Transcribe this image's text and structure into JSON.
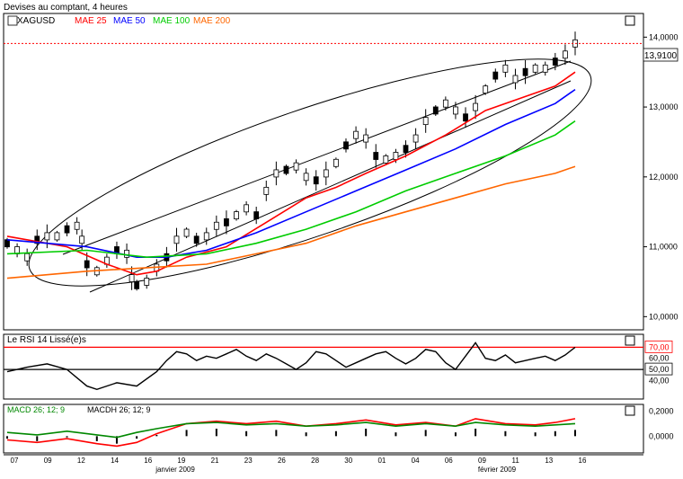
{
  "header": {
    "title": "Devises au comptant, 4 heures"
  },
  "main_panel": {
    "symbol": "XAGUSD",
    "legend": [
      {
        "label": "MAE 25",
        "color": "#ff0000"
      },
      {
        "label": "MAE 50",
        "color": "#0000ff"
      },
      {
        "label": "MAE 100",
        "color": "#00cc00"
      },
      {
        "label": "MAE 200",
        "color": "#ff6600"
      }
    ],
    "price_marker": "13,9100"
  },
  "rsi_panel": {
    "label": "Le RSI 14 Lissé(e)s"
  },
  "macd_panel": {
    "label_macd": "MACD 26; 12; 9",
    "label_macdh": "MACDH 26; 12; 9"
  },
  "colors": {
    "candle": "#000000",
    "ma25": "#ff0000",
    "ma50": "#0000ff",
    "ma100": "#00cc00",
    "ma200": "#ff6600",
    "priceLine": "#ff0000",
    "rsi": "#000000",
    "macd": "#ff0000",
    "signal": "#008800",
    "hist": "#000000"
  },
  "chart_data": [
    {
      "type": "line",
      "title": "XAGUSD",
      "ylim": [
        9.85,
        14.3
      ],
      "y_ticks": [
        10.0,
        11.0,
        12.0,
        13.0,
        14.0
      ],
      "y_tick_labels": [
        "10,0000",
        "11,0000",
        "12,0000",
        "13,0000",
        "14,0000"
      ],
      "x_tick_labels": [
        "07",
        "09",
        "12",
        "14",
        "16",
        "19",
        "21",
        "23",
        "26",
        "28",
        "30",
        "01",
        "04",
        "06",
        "09",
        "11",
        "13",
        "16"
      ],
      "x_month_labels": [
        "janvier 2009",
        "février 2009"
      ],
      "last_price": 13.91,
      "series": [
        {
          "name": "XAGUSD",
          "kind": "candlestick",
          "values": [
            [
              0.0,
              11.05
            ],
            [
              1.0,
              10.95
            ],
            [
              2.0,
              10.85
            ],
            [
              3.0,
              11.1
            ],
            [
              4.0,
              11.15
            ],
            [
              5.0,
              11.15
            ],
            [
              6.0,
              11.25
            ],
            [
              7.0,
              11.3
            ],
            [
              7.5,
              11.1
            ],
            [
              8.0,
              10.75
            ],
            [
              9.0,
              10.65
            ],
            [
              10.0,
              10.8
            ],
            [
              11.0,
              10.95
            ],
            [
              12.0,
              10.9
            ],
            [
              12.5,
              10.55
            ],
            [
              13.0,
              10.45
            ],
            [
              14.0,
              10.5
            ],
            [
              15.0,
              10.7
            ],
            [
              16.0,
              10.85
            ],
            [
              17.0,
              11.1
            ],
            [
              18.0,
              11.2
            ],
            [
              19.0,
              11.1
            ],
            [
              20.0,
              11.15
            ],
            [
              21.0,
              11.3
            ],
            [
              22.0,
              11.35
            ],
            [
              23.0,
              11.45
            ],
            [
              24.0,
              11.55
            ],
            [
              25.0,
              11.45
            ],
            [
              26.0,
              11.8
            ],
            [
              27.0,
              12.05
            ],
            [
              28.0,
              12.1
            ],
            [
              29.0,
              12.15
            ],
            [
              30.0,
              12.0
            ],
            [
              31.0,
              11.95
            ],
            [
              32.0,
              12.05
            ],
            [
              33.0,
              12.2
            ],
            [
              34.0,
              12.45
            ],
            [
              35.0,
              12.6
            ],
            [
              36.0,
              12.55
            ],
            [
              37.0,
              12.3
            ],
            [
              38.0,
              12.25
            ],
            [
              39.0,
              12.3
            ],
            [
              40.0,
              12.4
            ],
            [
              41.0,
              12.55
            ],
            [
              42.0,
              12.8
            ],
            [
              43.0,
              12.95
            ],
            [
              44.0,
              13.05
            ],
            [
              45.0,
              12.95
            ],
            [
              46.0,
              12.85
            ],
            [
              47.0,
              13.0
            ],
            [
              48.0,
              13.25
            ],
            [
              49.0,
              13.45
            ],
            [
              50.0,
              13.55
            ],
            [
              51.0,
              13.4
            ],
            [
              52.0,
              13.5
            ],
            [
              53.0,
              13.55
            ],
            [
              54.0,
              13.55
            ],
            [
              55.0,
              13.65
            ],
            [
              56.0,
              13.75
            ],
            [
              57.0,
              13.91
            ]
          ]
        },
        {
          "name": "MAE 25",
          "values": [
            [
              0.0,
              11.15
            ],
            [
              6.0,
              11.0
            ],
            [
              10.0,
              10.75
            ],
            [
              13.0,
              10.6
            ],
            [
              15.0,
              10.65
            ],
            [
              18.0,
              10.85
            ],
            [
              22.0,
              11.0
            ],
            [
              26.0,
              11.35
            ],
            [
              30.0,
              11.7
            ],
            [
              33.0,
              11.85
            ],
            [
              36.0,
              12.05
            ],
            [
              40.0,
              12.3
            ],
            [
              44.0,
              12.6
            ],
            [
              48.0,
              12.95
            ],
            [
              52.0,
              13.15
            ],
            [
              55.0,
              13.3
            ],
            [
              57.0,
              13.5
            ]
          ]
        },
        {
          "name": "MAE 50",
          "values": [
            [
              0.0,
              11.1
            ],
            [
              8.0,
              11.0
            ],
            [
              13.0,
              10.85
            ],
            [
              16.0,
              10.85
            ],
            [
              20.0,
              10.95
            ],
            [
              25.0,
              11.2
            ],
            [
              30.0,
              11.5
            ],
            [
              35.0,
              11.8
            ],
            [
              40.0,
              12.1
            ],
            [
              45.0,
              12.4
            ],
            [
              50.0,
              12.75
            ],
            [
              55.0,
              13.05
            ],
            [
              57.0,
              13.25
            ]
          ]
        },
        {
          "name": "MAE 100",
          "values": [
            [
              0.0,
              10.9
            ],
            [
              8.0,
              10.95
            ],
            [
              14.0,
              10.85
            ],
            [
              20.0,
              10.9
            ],
            [
              25.0,
              11.05
            ],
            [
              30.0,
              11.25
            ],
            [
              35.0,
              11.5
            ],
            [
              40.0,
              11.8
            ],
            [
              45.0,
              12.05
            ],
            [
              50.0,
              12.3
            ],
            [
              55.0,
              12.6
            ],
            [
              57.0,
              12.8
            ]
          ]
        },
        {
          "name": "MAE 200",
          "values": [
            [
              0.0,
              10.55
            ],
            [
              8.0,
              10.65
            ],
            [
              14.0,
              10.7
            ],
            [
              20.0,
              10.75
            ],
            [
              25.0,
              10.9
            ],
            [
              30.0,
              11.05
            ],
            [
              35.0,
              11.3
            ],
            [
              40.0,
              11.5
            ],
            [
              45.0,
              11.7
            ],
            [
              50.0,
              11.9
            ],
            [
              55.0,
              12.05
            ],
            [
              57.0,
              12.15
            ]
          ]
        }
      ]
    },
    {
      "type": "line",
      "title": "Le RSI 14 Lissé(e)s",
      "ylim": [
        25,
        80
      ],
      "y_ticks": [
        40,
        60
      ],
      "y_tick_labels": [
        "40,00",
        "60,00"
      ],
      "reference_lines": [
        {
          "value": 70,
          "label": "70,00",
          "color": "#ff0000"
        },
        {
          "value": 50,
          "label": "50,00",
          "color": "#000000"
        }
      ],
      "series": [
        {
          "name": "RSI",
          "values": [
            [
              0,
              48
            ],
            [
              2,
              52
            ],
            [
              4,
              55
            ],
            [
              6,
              50
            ],
            [
              8,
              35
            ],
            [
              9,
              32
            ],
            [
              11,
              38
            ],
            [
              13,
              35
            ],
            [
              15,
              48
            ],
            [
              16,
              58
            ],
            [
              17,
              66
            ],
            [
              18,
              64
            ],
            [
              19,
              58
            ],
            [
              20,
              62
            ],
            [
              21,
              60
            ],
            [
              22,
              64
            ],
            [
              23,
              68
            ],
            [
              24,
              62
            ],
            [
              25,
              58
            ],
            [
              26,
              64
            ],
            [
              27,
              60
            ],
            [
              28,
              55
            ],
            [
              29,
              50
            ],
            [
              30,
              56
            ],
            [
              31,
              66
            ],
            [
              32,
              64
            ],
            [
              33,
              58
            ],
            [
              34,
              52
            ],
            [
              35,
              56
            ],
            [
              36,
              60
            ],
            [
              37,
              64
            ],
            [
              38,
              66
            ],
            [
              39,
              60
            ],
            [
              40,
              55
            ],
            [
              41,
              60
            ],
            [
              42,
              68
            ],
            [
              43,
              66
            ],
            [
              44,
              56
            ],
            [
              45,
              50
            ],
            [
              46,
              62
            ],
            [
              47,
              74
            ],
            [
              48,
              60
            ],
            [
              49,
              58
            ],
            [
              50,
              63
            ],
            [
              51,
              56
            ],
            [
              52,
              58
            ],
            [
              53,
              60
            ],
            [
              54,
              62
            ],
            [
              55,
              58
            ],
            [
              56,
              63
            ],
            [
              57,
              70
            ]
          ]
        }
      ]
    },
    {
      "type": "bar",
      "title": "MACD 26; 12; 9",
      "ylim": [
        -0.12,
        0.24
      ],
      "y_ticks": [
        0.0,
        0.2
      ],
      "y_tick_labels": [
        "0,0000",
        "0,2000"
      ],
      "series": [
        {
          "name": "MACD",
          "values": [
            [
              0,
              -0.03
            ],
            [
              3,
              -0.05
            ],
            [
              6,
              -0.02
            ],
            [
              9,
              -0.06
            ],
            [
              11,
              -0.08
            ],
            [
              13,
              -0.05
            ],
            [
              15,
              0.02
            ],
            [
              18,
              0.1
            ],
            [
              21,
              0.12
            ],
            [
              24,
              0.1
            ],
            [
              27,
              0.12
            ],
            [
              30,
              0.08
            ],
            [
              33,
              0.1
            ],
            [
              36,
              0.13
            ],
            [
              39,
              0.09
            ],
            [
              42,
              0.11
            ],
            [
              45,
              0.08
            ],
            [
              47,
              0.14
            ],
            [
              50,
              0.1
            ],
            [
              53,
              0.09
            ],
            [
              55,
              0.11
            ],
            [
              57,
              0.14
            ]
          ]
        },
        {
          "name": "MACDH 26; 12; 9",
          "values": [
            [
              0,
              -0.02
            ],
            [
              3,
              -0.04
            ],
            [
              6,
              -0.01
            ],
            [
              9,
              -0.04
            ],
            [
              11,
              -0.06
            ],
            [
              13,
              -0.02
            ],
            [
              15,
              0.01
            ],
            [
              18,
              0.05
            ],
            [
              21,
              0.06
            ],
            [
              24,
              0.04
            ],
            [
              27,
              0.05
            ],
            [
              30,
              0.03
            ],
            [
              33,
              0.04
            ],
            [
              36,
              0.06
            ],
            [
              39,
              0.03
            ],
            [
              42,
              0.05
            ],
            [
              45,
              0.03
            ],
            [
              47,
              0.06
            ],
            [
              50,
              0.04
            ],
            [
              53,
              0.03
            ],
            [
              55,
              0.04
            ],
            [
              57,
              0.05
            ]
          ]
        }
      ]
    }
  ]
}
